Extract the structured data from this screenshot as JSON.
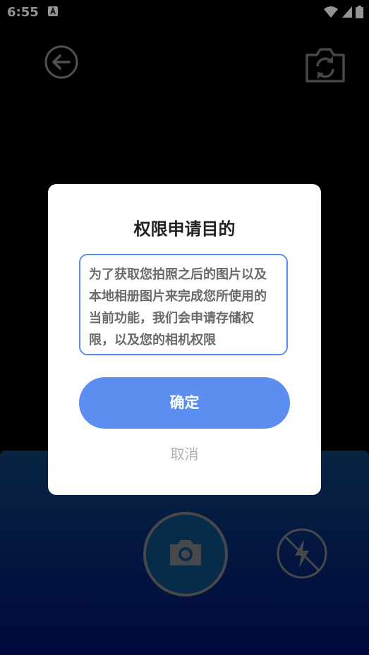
{
  "status_bar": {
    "time": "6:55"
  },
  "dialog": {
    "title": "权限申请目的",
    "message": "为了获取您拍照之后的图片以及本地相册图片来完成您所使用的当前功能，我们会申请存储权限，以及您的相机权限",
    "confirm_label": "确定",
    "cancel_label": "取消"
  },
  "icons": {
    "back": "arrow-left-circle-icon",
    "switch_camera": "camera-switch-icon",
    "shutter": "camera-icon",
    "flash": "flash-off-icon"
  },
  "colors": {
    "accent": "#5b8ef0",
    "panel_top": "#0e3f72",
    "panel_bottom": "#01106a"
  }
}
